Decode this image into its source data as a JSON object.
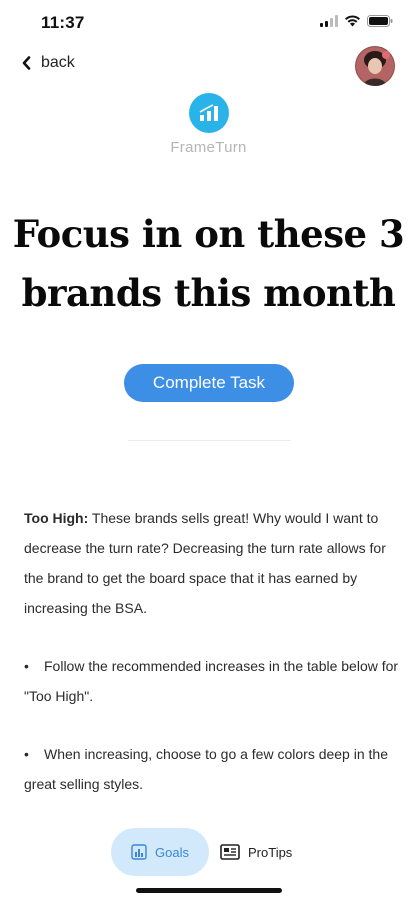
{
  "status_bar": {
    "time": "11:37",
    "icons": [
      "signal-icon",
      "wifi-icon",
      "battery-icon"
    ]
  },
  "nav": {
    "back_label": "back",
    "back_icon": "chevron-left-icon"
  },
  "brand": {
    "name": "FrameTurn",
    "logo_icon": "bar-chart-icon",
    "logo_color": "#29b3e8"
  },
  "headline": {
    "line1": "Focus in on these 3",
    "line2": "brands this month"
  },
  "actions": {
    "complete_task_label": "Complete Task",
    "accent": "#3d8fe6"
  },
  "content": {
    "intro_label": "Too High:",
    "intro_text": " These brands sells great! Why would I want to decrease the turn rate? Decreasing the turn rate allows for the brand to get the board space that it has earned by increasing the BSA.",
    "bullets": [
      "Follow the recommended increases in the table below for \"Too High\".",
      "When increasing, choose to go a few colors deep in the great selling styles."
    ],
    "bullet_symbol": "•"
  },
  "tabs": [
    {
      "label": "Goals",
      "icon": "chart-icon",
      "active": true
    },
    {
      "label": "ProTips",
      "icon": "newspaper-icon",
      "active": false
    }
  ]
}
